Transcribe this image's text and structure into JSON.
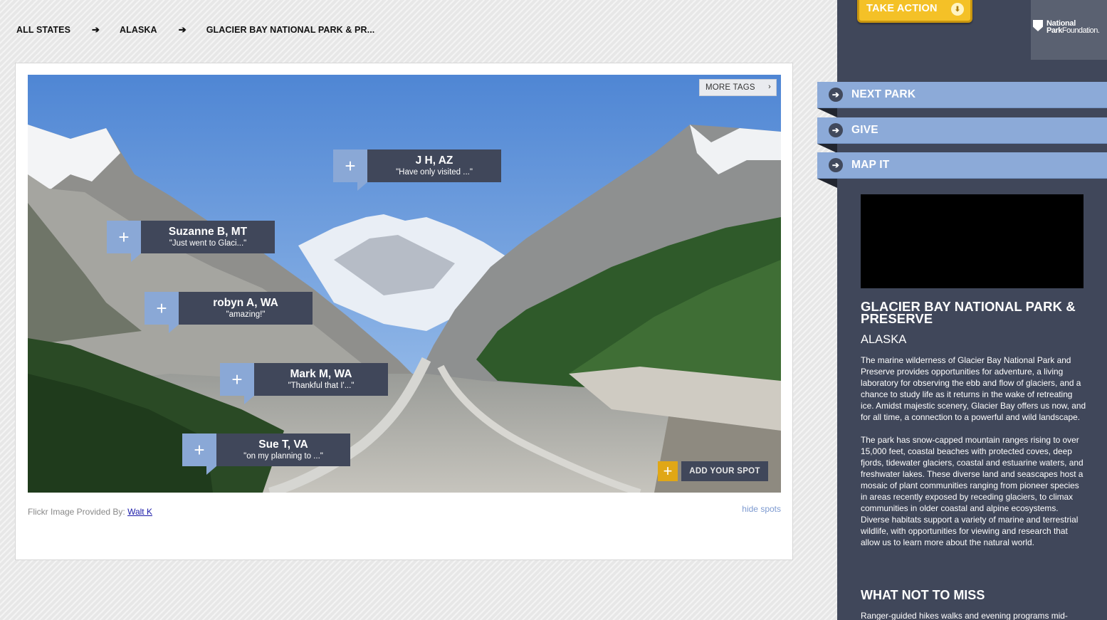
{
  "breadcrumb": {
    "items": [
      "ALL STATES",
      "ALASKA",
      "GLACIER BAY NATIONAL PARK & PR..."
    ],
    "separator": "➔"
  },
  "photo": {
    "more_tags_label": "MORE TAGS",
    "more_tags_chevron": "›",
    "spots": [
      {
        "name": "J H, AZ",
        "quote": "\"Have only visited ...\""
      },
      {
        "name": "Suzanne B, MT",
        "quote": "\"Just went to Glaci...\""
      },
      {
        "name": "robyn A, WA",
        "quote": "\"amazing!\""
      },
      {
        "name": "Mark M, WA",
        "quote": "\"Thankful that I'...\""
      },
      {
        "name": "Sue T, VA",
        "quote": "\"on my planning to ...\""
      }
    ],
    "plus_glyph": "+",
    "add_spot_label": "ADD YOUR SPOT"
  },
  "credit": {
    "prefix": "Flickr Image Provided By:",
    "author": "Walt K"
  },
  "hide_spots_label": "hide spots",
  "sidebar": {
    "take_action_label": "TAKE ACTION",
    "take_action_icon": "⬇",
    "logo": {
      "line1": "National",
      "line2_bold": "Park",
      "line2_rest": "Foundation."
    },
    "nav": [
      {
        "label": "NEXT PARK",
        "icon": "➔"
      },
      {
        "label": "GIVE",
        "icon": "➔"
      },
      {
        "label": "MAP IT",
        "icon": "➔"
      }
    ],
    "park_title": "GLACIER BAY NATIONAL PARK & PRESERVE",
    "park_state": "ALASKA",
    "description": [
      "The marine wilderness of Glacier Bay National Park and Preserve provides opportunities for adventure, a living laboratory for observing the ebb and flow of glaciers, and a chance to study life as it returns in the wake of retreating ice. Amidst majestic scenery, Glacier Bay offers us now, and for all time, a connection to a powerful and wild landscape.",
      "The park has snow-capped mountain ranges rising to over 15,000 feet, coastal beaches with protected coves, deep fjords, tidewater glaciers, coastal and estuarine waters, and freshwater lakes. These diverse land and seascapes host a mosaic of plant communities ranging from pioneer species in areas recently exposed by receding glaciers, to climax communities in older coastal and alpine ecosystems. Diverse habitats support a variety of marine and terrestrial wildlife, with opportunities for viewing and research that allow us to learn more about the natural world."
    ],
    "what_not_to_miss_title": "WHAT NOT TO MISS",
    "what_not_to_miss_text": "Ranger-guided hikes walks and evening programs mid-"
  },
  "colors": {
    "sidebar_bg": "#40475a",
    "nav_button": "#8caad8",
    "take_action": "#f4c127",
    "spot_plus": "#8aa8d6",
    "spot_info": "#40475a",
    "add_spot_plus": "#e0a716"
  }
}
